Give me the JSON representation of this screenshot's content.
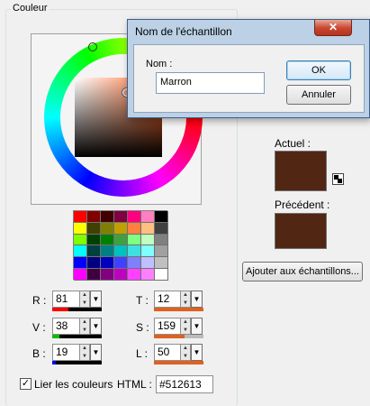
{
  "group": {
    "title": "Couleur"
  },
  "palette": {
    "colors": [
      "#ff0000",
      "#800000",
      "#400000",
      "#800040",
      "#ff0080",
      "#ff80c0",
      "#000000",
      "#ffff00",
      "#404000",
      "#808000",
      "#c0a000",
      "#ff8040",
      "#ffc080",
      "#404040",
      "#80ff00",
      "#004000",
      "#008000",
      "#40a040",
      "#80ff80",
      "#c0ffc0",
      "#808080",
      "#00ffff",
      "#004040",
      "#008080",
      "#00c0c0",
      "#40e0e0",
      "#80ffff",
      "#a0a0a0",
      "#0000ff",
      "#000080",
      "#0000c0",
      "#4040ff",
      "#8080ff",
      "#c0c0ff",
      "#c0c0c0",
      "#ff00ff",
      "#400040",
      "#800080",
      "#c000c0",
      "#ff40ff",
      "#ff80ff",
      "#ffffff"
    ]
  },
  "fields": {
    "r": {
      "label": "R :",
      "value": "81",
      "fill": 0.32,
      "color": "#ff0000"
    },
    "v": {
      "label": "V :",
      "value": "38",
      "fill": 0.15,
      "color": "#00c000"
    },
    "b": {
      "label": "B :",
      "value": "19",
      "fill": 0.07,
      "color": "#0000ff"
    },
    "t": {
      "label": "T :",
      "value": "12",
      "fill": 0.05,
      "color": "#e06020"
    },
    "s": {
      "label": "S :",
      "value": "159",
      "fill": 0.62,
      "color": "#e06020"
    },
    "l": {
      "label": "L :",
      "value": "50",
      "fill": 0.2,
      "color": "#e06020"
    }
  },
  "link_colors": {
    "label": "Lier les couleurs",
    "checked": true,
    "check_glyph": "✓"
  },
  "html_field": {
    "label": "HTML :",
    "value": "#512613"
  },
  "current": {
    "label": "Actuel :",
    "color": "#512613"
  },
  "previous": {
    "label": "Précédent :",
    "color": "#512613"
  },
  "add_button": {
    "label": "Ajouter aux échantillons..."
  },
  "dialog": {
    "title": "Nom de l'échantillon",
    "close_glyph": "✕",
    "name_label": "Nom :",
    "name_value": "Marron",
    "ok_label": "OK",
    "cancel_label": "Annuler"
  },
  "icons": {
    "spin_up": "▲",
    "spin_down": "▼",
    "dropdown": "▼"
  }
}
